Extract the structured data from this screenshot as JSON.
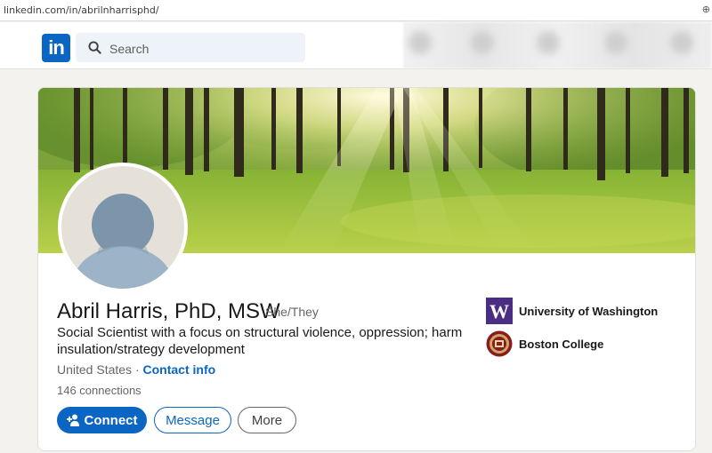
{
  "browser": {
    "url": "linkedin.com/in/abrilnharrisphd/"
  },
  "nav": {
    "logo_text": "in",
    "search_placeholder": "Search",
    "brand_color": "#0a66c2"
  },
  "profile": {
    "name": "Abril Harris, PhD, MSW",
    "pronouns": "She/They",
    "headline": "Social Scientist with a focus on structural violence, oppression; harm insulation/strategy development",
    "location": "United States",
    "separator": "·",
    "contact_info_label": "Contact info",
    "connections": "146 connections",
    "actions": {
      "connect": "Connect",
      "message": "Message",
      "more": "More"
    },
    "education": [
      {
        "name": "University of Washington",
        "logo_icon": "uw-logo-icon",
        "logo_color": "#4b2e83",
        "logo_letter": "W"
      },
      {
        "name": "Boston College",
        "logo_icon": "boston-college-seal-icon",
        "logo_color": "#8a1c1c"
      }
    ]
  }
}
